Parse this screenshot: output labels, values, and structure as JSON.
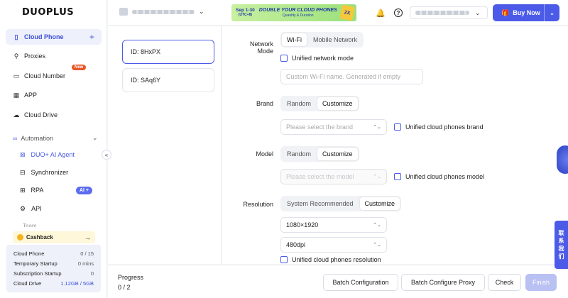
{
  "brand": {
    "logo": "DUOPLUS"
  },
  "sidebar": {
    "items": [
      {
        "label": "Cloud Phone",
        "icon": "phone-icon"
      },
      {
        "label": "Proxies",
        "icon": "proxy-icon"
      },
      {
        "label": "Cloud Number",
        "icon": "number-icon",
        "badge": "New"
      },
      {
        "label": "APP",
        "icon": "app-grid-icon"
      },
      {
        "label": "Cloud Drive",
        "icon": "cloud-icon"
      }
    ],
    "automation": {
      "label": "Automation",
      "items": [
        {
          "label": "DUO+ AI Agent"
        },
        {
          "label": "Synchronizer"
        },
        {
          "label": "RPA",
          "badge": "AI +"
        },
        {
          "label": "API"
        }
      ]
    },
    "team_label": "Team",
    "cashback": {
      "label": "Cashback"
    },
    "usage": [
      {
        "label": "Cloud Phone",
        "value": "0 / 15"
      },
      {
        "label": "Temporary Startup",
        "value": "0 mins"
      },
      {
        "label": "Subscription Startup",
        "value": "0"
      },
      {
        "label": "Cloud Drive",
        "value": "1.12GB / 5GB"
      }
    ]
  },
  "topbar": {
    "promo": {
      "date": "Sep 1-30",
      "tz": "(UTC+8)",
      "headline": "DOUBLE YOUR CLOUD PHONES",
      "sub": "Quantity & Duration",
      "deco": "2X"
    },
    "buy_label": "Buy Now"
  },
  "devices": [
    {
      "label": "ID: 8HxPX",
      "selected": true
    },
    {
      "label": "ID: SAq6Y",
      "selected": false
    }
  ],
  "config": {
    "network": {
      "label_line1": "Network",
      "label_line2": "Mode",
      "options": [
        "Wi-Fi",
        "Mobile Network"
      ],
      "selected": "Wi-Fi",
      "unified_label": "Unified network mode",
      "wifi_placeholder": "Custom Wi-Fi name. Generated if empty"
    },
    "brand": {
      "label": "Brand",
      "options": [
        "Random",
        "Customize"
      ],
      "selected": "Customize",
      "select_placeholder": "Please select the brand",
      "unified_label": "Unified cloud phones brand"
    },
    "model": {
      "label": "Model",
      "options": [
        "Random",
        "Customize"
      ],
      "selected": "Customize",
      "select_placeholder": "Please select the model",
      "unified_label": "Unified cloud phones model"
    },
    "resolution": {
      "label": "Resolution",
      "options": [
        "System Recommended",
        "Customize"
      ],
      "selected": "Customize",
      "size_value": "1080×1920",
      "dpi_value": "480dpi",
      "unified_label": "Unified cloud phones resolution"
    }
  },
  "bottom": {
    "progress_label": "Progress",
    "progress_value": "0 / 2",
    "buttons": {
      "batch_config": "Batch Configuration",
      "batch_proxy": "Batch Configure Proxy",
      "check": "Check",
      "finish": "Finish"
    }
  },
  "support_text": [
    "联",
    "系",
    "我",
    "们"
  ],
  "colors": {
    "accent": "#4b5be8",
    "accent_light": "#eef0fb",
    "finish_disabled": "#b9c0f2"
  }
}
